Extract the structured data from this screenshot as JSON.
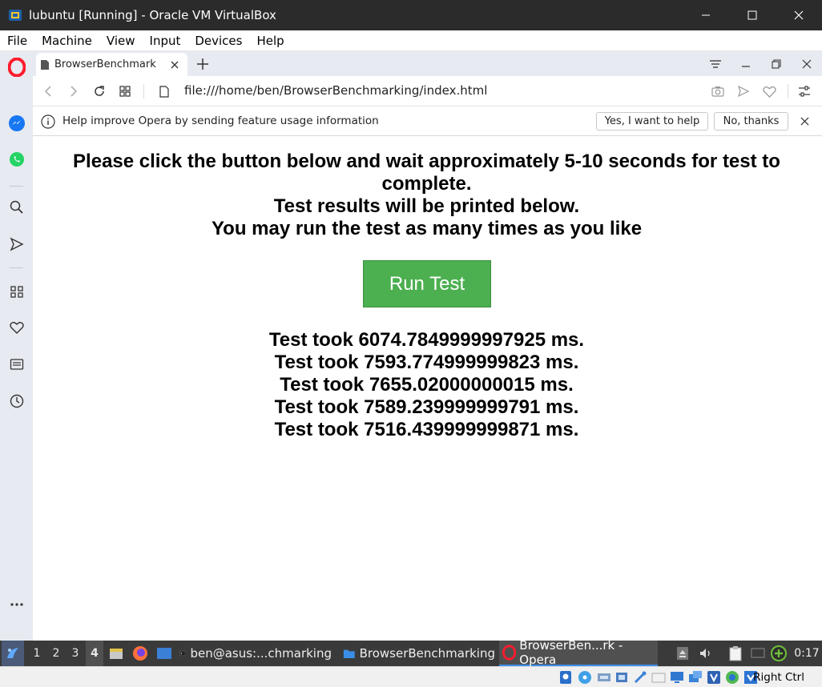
{
  "window": {
    "title": "lubuntu [Running] - Oracle VM VirtualBox"
  },
  "vbox_menu": [
    "File",
    "Machine",
    "View",
    "Input",
    "Devices",
    "Help"
  ],
  "opera": {
    "tab": {
      "title": "BrowserBenchmark"
    },
    "url": "file:///home/ben/BrowserBenchmarking/index.html",
    "infobar": {
      "message": "Help improve Opera by sending feature usage information",
      "accept_label": "Yes, I want to help",
      "decline_label": "No, thanks"
    }
  },
  "page": {
    "instruction_lines": [
      "Please click the button below and wait approximately 5-10 seconds for test to",
      "complete.",
      "Test results will be printed below.",
      "You may run the test as many times as you like"
    ],
    "run_button_label": "Run Test",
    "results": [
      "Test took 6074.7849999997925 ms.",
      "Test took 7593.774999999823 ms.",
      "Test took 7655.02000000015 ms.",
      "Test took 7589.239999999791 ms.",
      "Test took 7516.439999999871 ms."
    ]
  },
  "taskbar": {
    "workspaces": [
      "1",
      "2",
      "3",
      "4"
    ],
    "active_workspace": "4",
    "tasks": [
      {
        "label": "ben@asus:...chmarking",
        "icon": "terminal-icon"
      },
      {
        "label": "BrowserBenchmarking",
        "icon": "folder-icon"
      },
      {
        "label": "BrowserBen...rk - Opera",
        "icon": "opera-icon"
      }
    ],
    "clock": "0:17"
  },
  "vbox_status": {
    "host_key": "Right Ctrl"
  },
  "colors": {
    "run_button": "#4caf50",
    "opera_red": "#ff1b2d",
    "taskbar": "#3a3a3a",
    "titlebar": "#2b2b2b"
  }
}
